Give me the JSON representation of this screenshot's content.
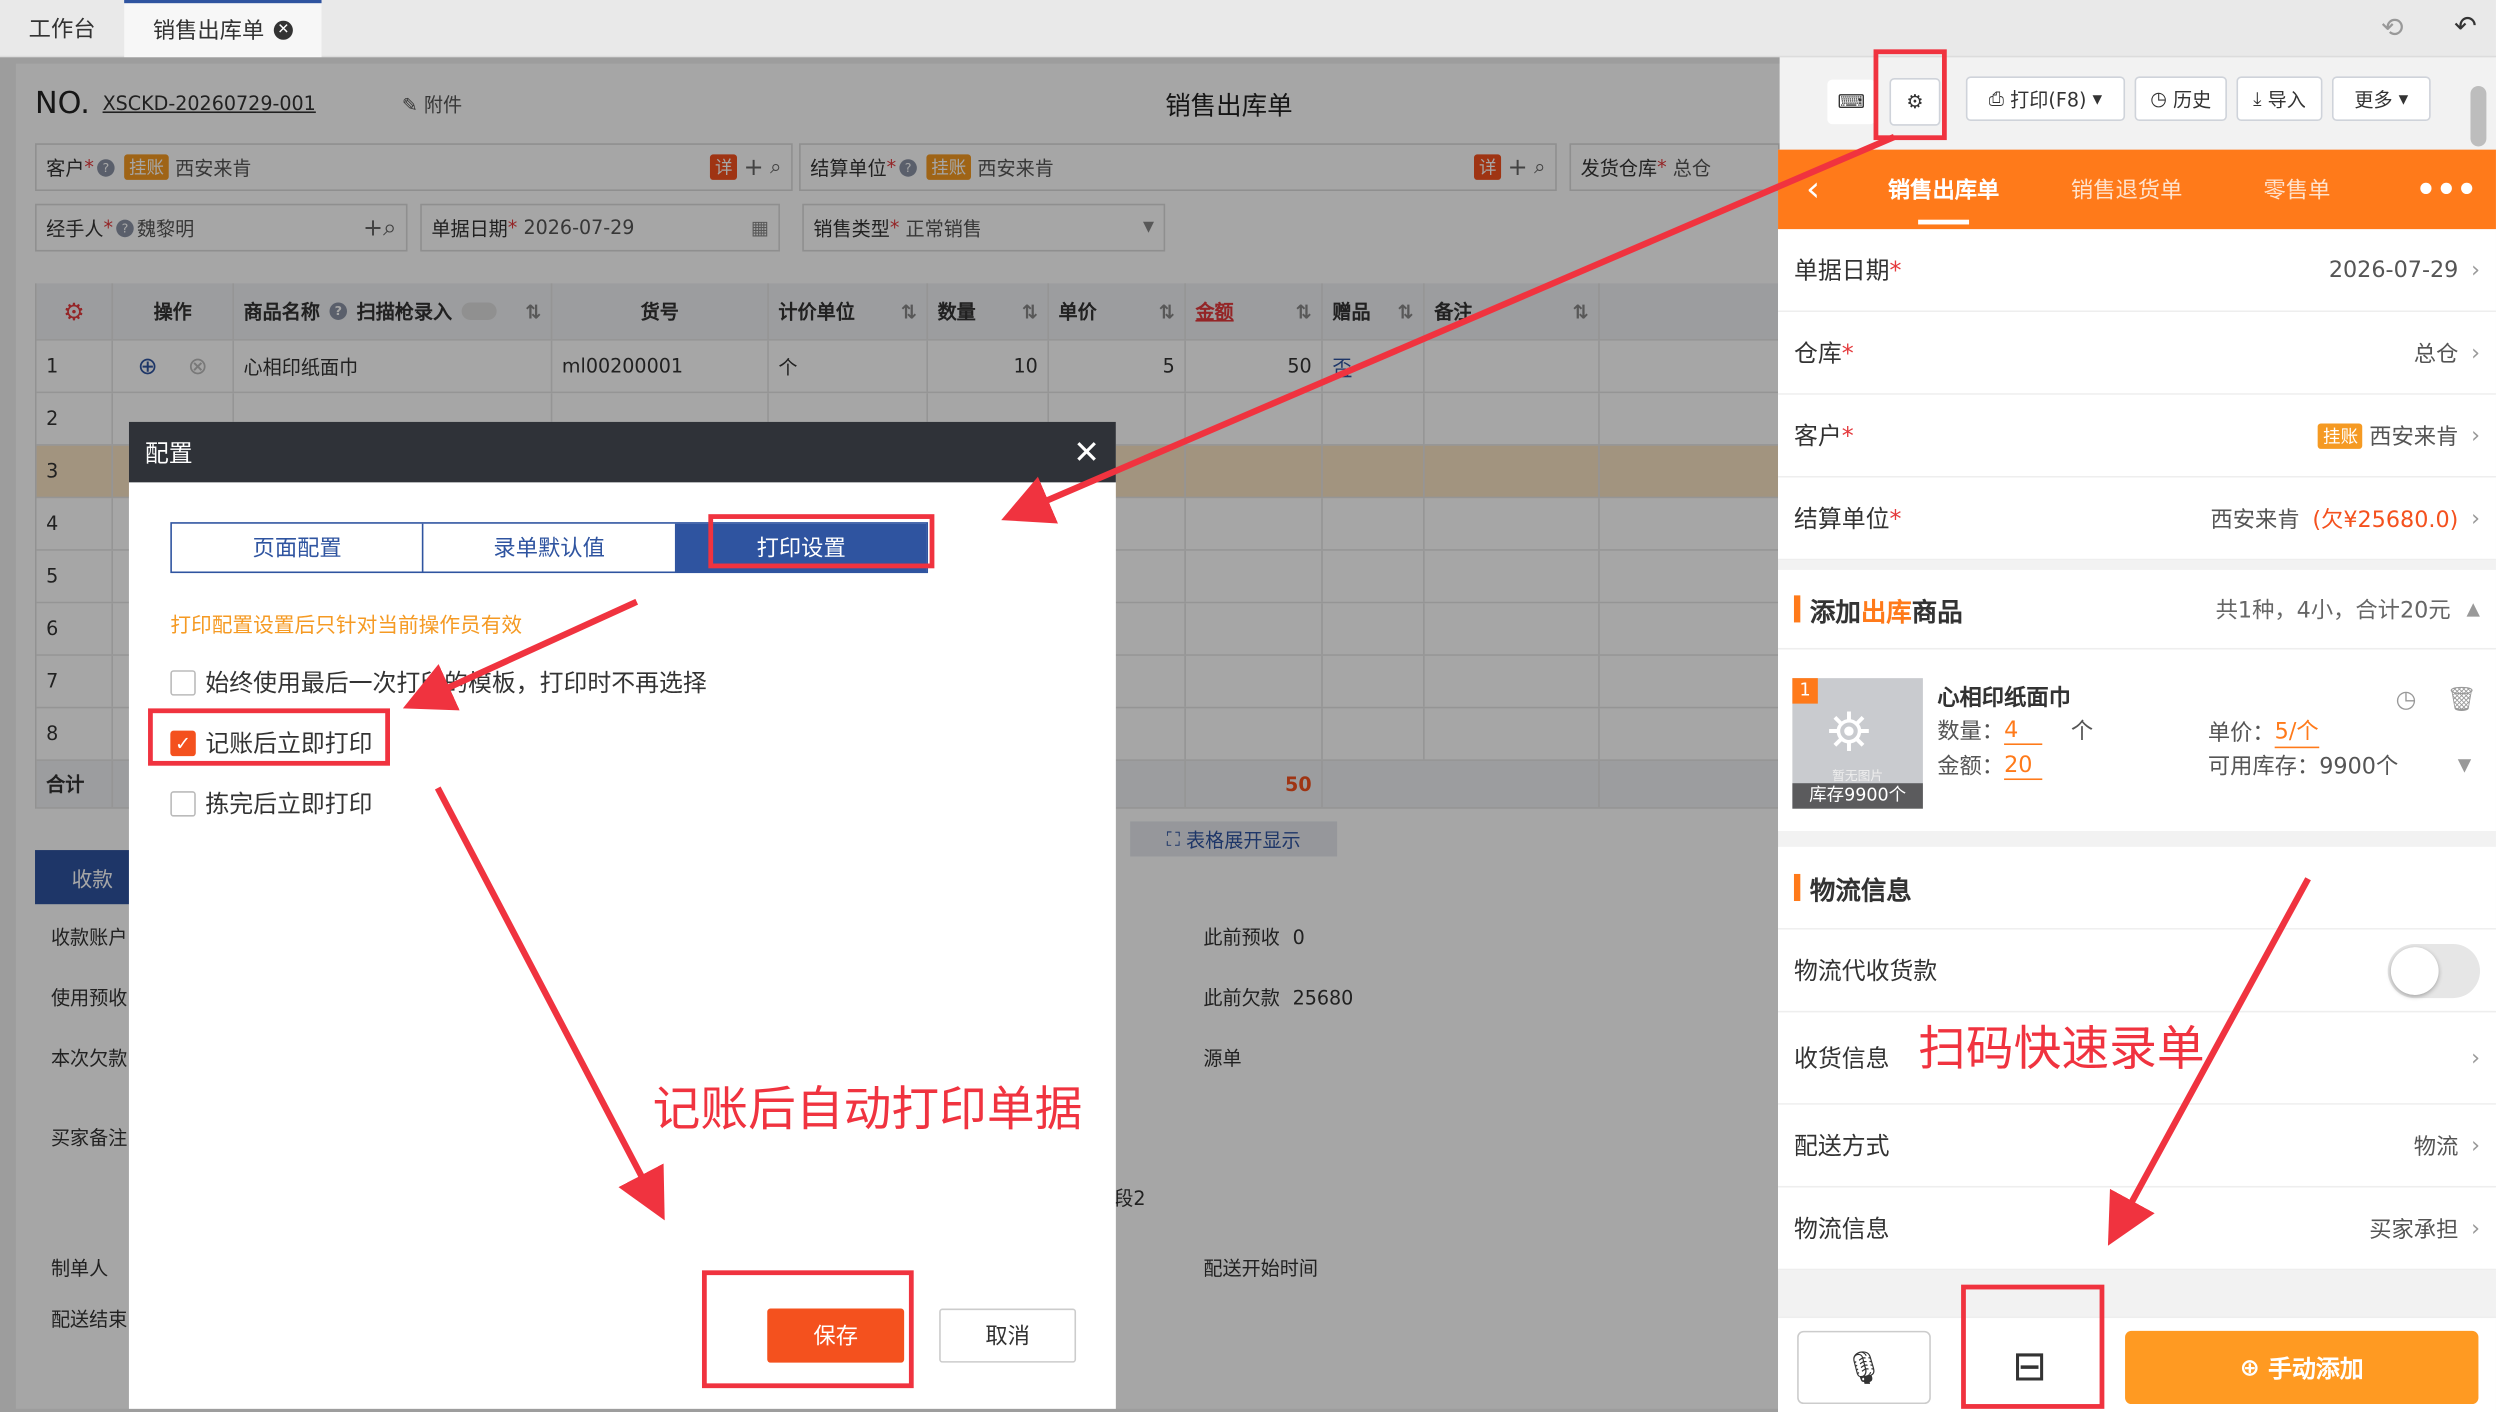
{
  "tabs": {
    "workbench": "工作台",
    "sales_out": "销售出库单"
  },
  "header": {
    "no_label": "NO.",
    "no_value": "XSCKD-20260729-001",
    "attach": "附件",
    "title": "销售出库单"
  },
  "toolbar": {
    "print": "打印(F8)",
    "history": "历史",
    "import": "导入",
    "more": "更多"
  },
  "form": {
    "customer_label": "客户",
    "customer_tag": "挂账",
    "customer_value": "西安来肯",
    "detail_tag": "详",
    "settle_label": "结算单位",
    "settle_tag": "挂账",
    "settle_value": "西安来肯",
    "warehouse_label": "发货仓库",
    "warehouse_value": "总仓",
    "handler_label": "经手人",
    "handler_value": "魏黎明",
    "date_label": "单据日期",
    "date_value": "2026-07-29",
    "type_label": "销售类型",
    "type_value": "正常销售"
  },
  "table": {
    "headers": [
      "操作",
      "商品名称",
      "扫描枪录入",
      "货号",
      "计价单位",
      "数量",
      "单价",
      "金额",
      "赠品",
      "备注"
    ],
    "row1": {
      "idx": "1",
      "name": "心相印纸面巾",
      "sku": "ml00200001",
      "unit": "个",
      "qty": "10",
      "price": "5",
      "amount": "50",
      "gift": "否"
    },
    "row_indexes": [
      "2",
      "3",
      "4",
      "5",
      "6",
      "7",
      "8"
    ],
    "total_label": "合计",
    "total_amount": "50",
    "expand": "表格展开显示"
  },
  "lower": {
    "tab_receive": "收款",
    "l1": "收款账户",
    "l2": "使用预收",
    "l3": "本次欠款",
    "l4": "买家备注",
    "l5": "制单人",
    "l6": "配送结束",
    "prev_prepay_label": "此前预收",
    "prev_prepay_value": "0",
    "prev_debt_label": "此前欠款",
    "prev_debt_value": "25680",
    "source_label": "源单",
    "seg2": "段2",
    "delivery_start": "配送开始时间"
  },
  "modal": {
    "title": "配置",
    "tab1": "页面配置",
    "tab2": "录单默认值",
    "tab3": "打印设置",
    "note": "打印配置设置后只针对当前操作员有效",
    "opt1": "始终使用最后一次打印的模板，打印时不再选择",
    "opt2": "记账后立即打印",
    "opt3": "拣完后立即打印",
    "save": "保存",
    "cancel": "取消",
    "opt1_checked": false,
    "opt2_checked": true,
    "opt3_checked": false
  },
  "annotations": {
    "auto_print": "记账后自动打印单据",
    "scan_quick": "扫码快速录单"
  },
  "mobile": {
    "tab1": "销售出库单",
    "tab2": "销售退货单",
    "tab3": "零售单",
    "date_label": "单据日期",
    "date_value": "2026-07-29",
    "warehouse_label": "仓库",
    "warehouse_value": "总仓",
    "customer_label": "客户",
    "customer_tag": "挂账",
    "customer_value": "西安来肯",
    "settle_label": "结算单位",
    "settle_value": "西安来肯",
    "settle_debt": "(欠¥25680.0)",
    "add_title_1": "添加",
    "add_title_2": "出库",
    "add_title_3": "商品",
    "summary": "共1种，4小，合计20元",
    "item_index": "1",
    "item_name": "心相印纸面巾",
    "qty_label": "数量：",
    "qty_value": "4",
    "qty_unit": "个",
    "price_label": "单价：",
    "price_value": "5/个",
    "amount_label": "金额：",
    "amount_value": "20",
    "stock_label": "可用库存：",
    "stock_value": "9900个",
    "thumb_stock": "库存9900个",
    "thumb_caption": "暂无图片",
    "logistics_title": "物流信息",
    "cod_label": "物流代收货款",
    "recv_label": "收货信息",
    "ship_label": "配送方式",
    "ship_value": "物流",
    "logi_label": "物流信息",
    "logi_value": "买家承担",
    "manual_add": "手动添加"
  },
  "colors": {
    "accent_orange": "#ff7a1a",
    "brand_blue": "#2f54a0",
    "annotation_red": "#f0333f"
  }
}
